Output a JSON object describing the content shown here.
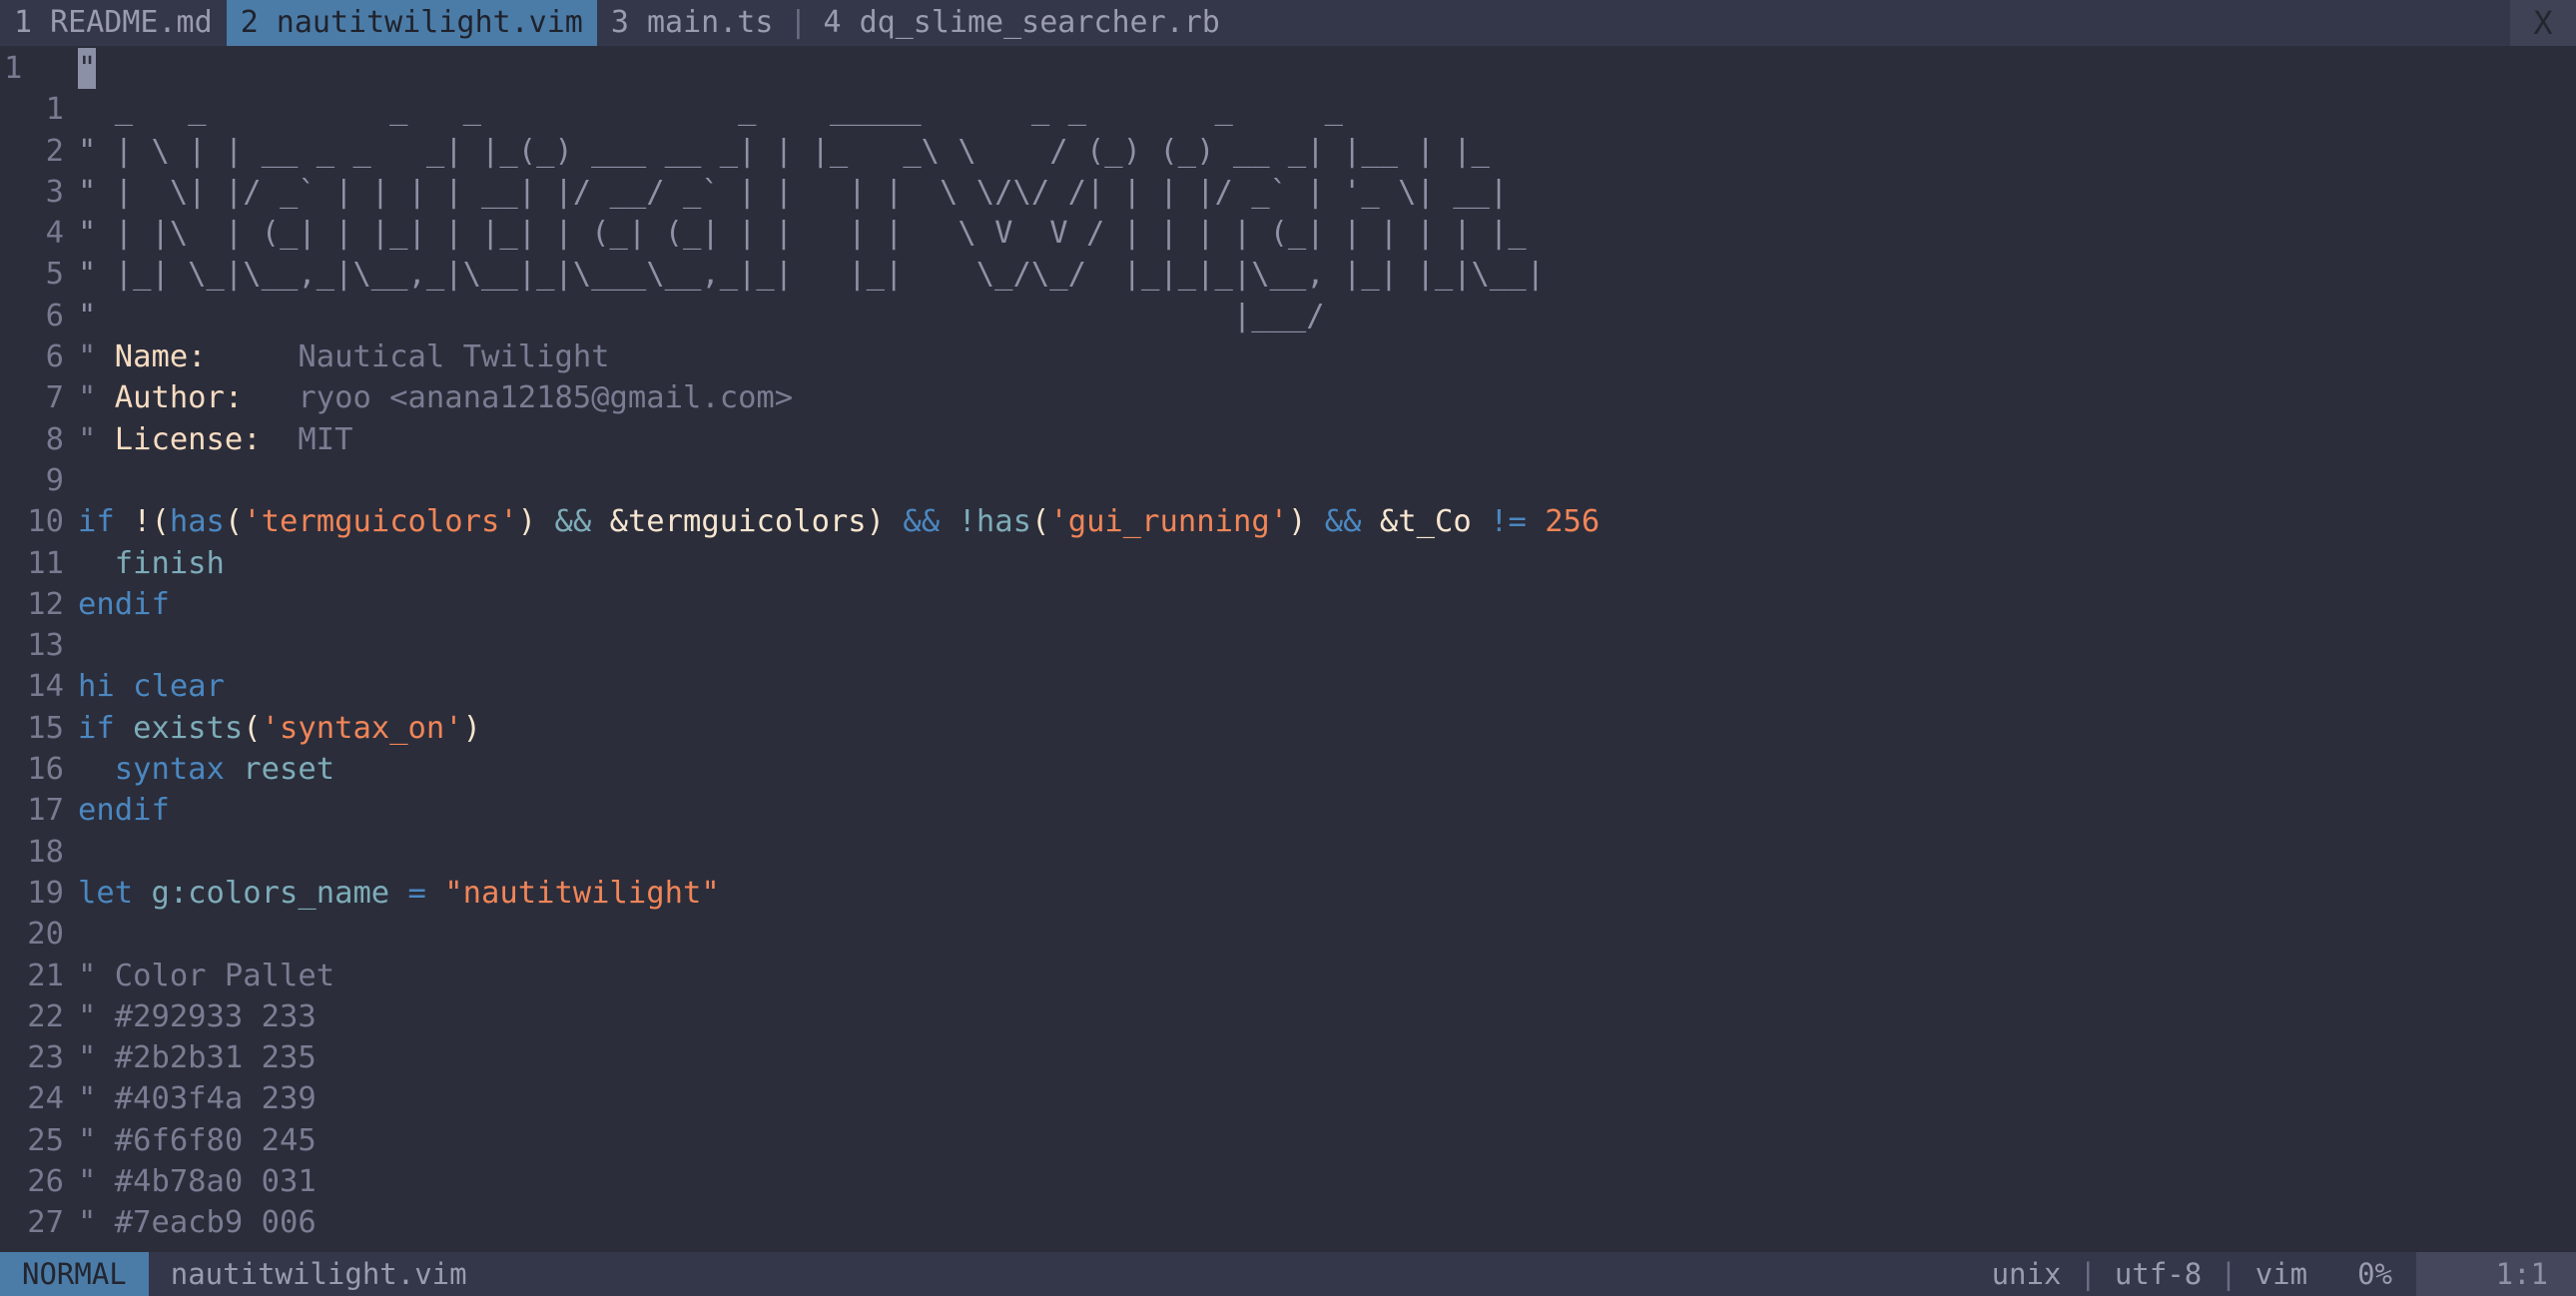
{
  "window": {
    "background": "#2b2d3a",
    "accent": "#4b7ca8"
  },
  "tabline": {
    "tabs": [
      {
        "index": "1",
        "label": "README.md",
        "text": "1 README.md",
        "active": false
      },
      {
        "index": "2",
        "label": "nautitwilight.vim",
        "text": "2 nautitwilight.vim",
        "active": true
      },
      {
        "index": "3",
        "label": "main.ts",
        "text": "3 main.ts",
        "active": false
      },
      {
        "index": "4",
        "label": "dq_slime_searcher.rb",
        "text": "4 dq_slime_searcher.rb",
        "active": false
      }
    ],
    "separator": "|",
    "close_label": "X"
  },
  "editor": {
    "cursor_char": "\"",
    "lines": [
      {
        "num": "1",
        "cursorline": true,
        "segments": [
          {
            "cls": "cursor-block c-comment",
            "t": "\""
          }
        ]
      },
      {
        "num": "1",
        "segments": [
          {
            "cls": "c-art",
            "t": "  _   _          _   _              _    _____      _ _       _     _   "
          }
        ]
      },
      {
        "num": "2",
        "segments": [
          {
            "cls": "c-art",
            "t": "\" | \\ | | __ _ _   _| |_(_) ___ __ _| | |_   _\\ \\    / (_) (_) __ _| |__ | |_ "
          }
        ]
      },
      {
        "num": "3",
        "segments": [
          {
            "cls": "c-art",
            "t": "\" |  \\| |/ _` | | | | __| |/ __/ _` | |   | |  \\ \\/\\/ /| | | |/ _` | '_ \\| __|"
          }
        ]
      },
      {
        "num": "4",
        "segments": [
          {
            "cls": "c-art",
            "t": "\" | |\\  | (_| | |_| | |_| | (_| (_| | |   | |   \\ V  V / | | | | (_| | | | | |_ "
          }
        ]
      },
      {
        "num": "5",
        "segments": [
          {
            "cls": "c-art",
            "t": "\" |_| \\_|\\__,_|\\__,_|\\__|_|\\___\\__,_|_|   |_|    \\_/\\_/  |_|_|_|\\__, |_| |_|\\__|"
          }
        ]
      },
      {
        "num": "6",
        "tail": true,
        "segments": [
          {
            "cls": "c-art",
            "t": "\"                                                              |___/          "
          }
        ]
      },
      {
        "num": "6",
        "kind": "name",
        "segments": [
          {
            "cls": "c-comment",
            "t": "\" "
          },
          {
            "cls": "c-hdr",
            "t": "Name:"
          },
          {
            "cls": "c-comment",
            "t": "     Nautical Twilight"
          }
        ]
      },
      {
        "num": "7",
        "segments": [
          {
            "cls": "c-comment",
            "t": "\" "
          },
          {
            "cls": "c-hdr",
            "t": "Author:"
          },
          {
            "cls": "c-comment",
            "t": "   ryoo <anana12185@gmail.com>"
          }
        ]
      },
      {
        "num": "8",
        "segments": [
          {
            "cls": "c-comment",
            "t": "\" "
          },
          {
            "cls": "c-hdr",
            "t": "License:"
          },
          {
            "cls": "c-comment",
            "t": "  MIT"
          }
        ]
      },
      {
        "num": "9",
        "segments": []
      },
      {
        "num": "10",
        "segments": [
          {
            "cls": "c-kw",
            "t": "if "
          },
          {
            "cls": "c-punct",
            "t": "!("
          },
          {
            "cls": "c-kw",
            "t": "has"
          },
          {
            "cls": "c-punct",
            "t": "("
          },
          {
            "cls": "c-str",
            "t": "'termguicolors'"
          },
          {
            "cls": "c-punct",
            "t": ") "
          },
          {
            "cls": "c-amp",
            "t": "&&"
          },
          {
            "cls": "c-punct",
            "t": " &termguicolors"
          },
          {
            "cls": "c-punct",
            "t": ") "
          },
          {
            "cls": "c-op",
            "t": "&&"
          },
          {
            "cls": "c-punct",
            "t": " "
          },
          {
            "cls": "c-func",
            "t": "!has"
          },
          {
            "cls": "c-punct",
            "t": "("
          },
          {
            "cls": "c-str",
            "t": "'gui_running'"
          },
          {
            "cls": "c-punct",
            "t": ") "
          },
          {
            "cls": "c-op",
            "t": "&&"
          },
          {
            "cls": "c-punct",
            "t": " &t_Co "
          },
          {
            "cls": "c-op",
            "t": "!="
          },
          {
            "cls": "c-punct",
            "t": " "
          },
          {
            "cls": "c-num",
            "t": "256"
          }
        ]
      },
      {
        "num": "11",
        "segments": [
          {
            "cls": "c-func",
            "t": "  finish"
          }
        ]
      },
      {
        "num": "12",
        "segments": [
          {
            "cls": "c-kw",
            "t": "endif"
          }
        ]
      },
      {
        "num": "13",
        "segments": []
      },
      {
        "num": "14",
        "segments": [
          {
            "cls": "c-kw",
            "t": "hi clear"
          }
        ]
      },
      {
        "num": "15",
        "segments": [
          {
            "cls": "c-kw",
            "t": "if "
          },
          {
            "cls": "c-func",
            "t": "exists"
          },
          {
            "cls": "c-punct",
            "t": "("
          },
          {
            "cls": "c-str",
            "t": "'syntax_on'"
          },
          {
            "cls": "c-punct",
            "t": ")"
          }
        ]
      },
      {
        "num": "16",
        "segments": [
          {
            "cls": "c-kw",
            "t": "  syntax "
          },
          {
            "cls": "c-func",
            "t": "reset"
          }
        ]
      },
      {
        "num": "17",
        "segments": [
          {
            "cls": "c-kw",
            "t": "endif"
          }
        ]
      },
      {
        "num": "18",
        "segments": []
      },
      {
        "num": "19",
        "segments": [
          {
            "cls": "c-kw",
            "t": "let "
          },
          {
            "cls": "c-func",
            "t": "g:colors_name"
          },
          {
            "cls": "c-op",
            "t": " = "
          },
          {
            "cls": "c-str",
            "t": "\"nautitwilight\""
          }
        ]
      },
      {
        "num": "20",
        "segments": []
      },
      {
        "num": "21",
        "segments": [
          {
            "cls": "c-comment",
            "t": "\" Color Pallet"
          }
        ]
      },
      {
        "num": "22",
        "segments": [
          {
            "cls": "c-comment",
            "t": "\" #292933 233"
          }
        ]
      },
      {
        "num": "23",
        "segments": [
          {
            "cls": "c-comment",
            "t": "\" #2b2b31 235"
          }
        ]
      },
      {
        "num": "24",
        "segments": [
          {
            "cls": "c-comment",
            "t": "\" #403f4a 239"
          }
        ]
      },
      {
        "num": "25",
        "segments": [
          {
            "cls": "c-comment",
            "t": "\" #6f6f80 245"
          }
        ]
      },
      {
        "num": "26",
        "segments": [
          {
            "cls": "c-comment",
            "t": "\" #4b78a0 031"
          }
        ]
      },
      {
        "num": "27",
        "segments": [
          {
            "cls": "c-comment",
            "t": "\" #7eacb9 006"
          }
        ]
      }
    ],
    "palette": [
      {
        "hex": "#292933",
        "code": "233"
      },
      {
        "hex": "#2b2b31",
        "code": "235"
      },
      {
        "hex": "#403f4a",
        "code": "239"
      },
      {
        "hex": "#6f6f80",
        "code": "245"
      },
      {
        "hex": "#4b78a0",
        "code": "031"
      },
      {
        "hex": "#7eacb9",
        "code": "006"
      }
    ],
    "header": {
      "name_label": "Name:",
      "name_value": "Nautical Twilight",
      "author_label": "Author:",
      "author_value": "ryoo <anana12185@gmail.com>",
      "license_label": "License:",
      "license_value": "MIT"
    }
  },
  "statusline": {
    "mode": "NORMAL",
    "filename": "nautitwilight.vim",
    "fileformat": "unix",
    "encoding": "utf-8",
    "filetype": "vim",
    "separator": "|",
    "percent": "0%",
    "position": "1:1"
  }
}
